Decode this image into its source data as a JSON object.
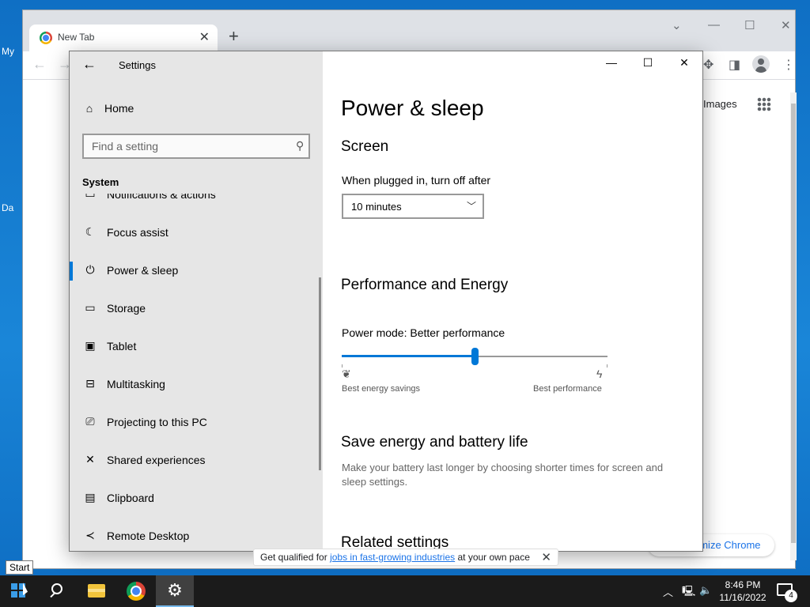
{
  "desktop": {
    "labels": [
      "My",
      "Da"
    ]
  },
  "chrome": {
    "tab_title": "New Tab",
    "tab_close": "✕",
    "new_tab": "+",
    "images_link": "Images",
    "customize_label": "omize Chrome"
  },
  "settings": {
    "window_title": "Settings",
    "back_icon": "←",
    "home_label": "Home",
    "search_placeholder": "Find a setting",
    "section_label": "System",
    "nav_items": [
      {
        "label": "Notifications & actions",
        "icon": "notifications-icon",
        "glyph": "▭"
      },
      {
        "label": "Focus assist",
        "icon": "moon-icon",
        "glyph": "☾"
      },
      {
        "label": "Power & sleep",
        "icon": "power-icon",
        "glyph": "⏻"
      },
      {
        "label": "Storage",
        "icon": "storage-icon",
        "glyph": "▭"
      },
      {
        "label": "Tablet",
        "icon": "tablet-icon",
        "glyph": "▣"
      },
      {
        "label": "Multitasking",
        "icon": "multitasking-icon",
        "glyph": "⊟"
      },
      {
        "label": "Projecting to this PC",
        "icon": "projecting-icon",
        "glyph": "⎚"
      },
      {
        "label": "Shared experiences",
        "icon": "shared-experiences-icon",
        "glyph": "✕"
      },
      {
        "label": "Clipboard",
        "icon": "clipboard-icon",
        "glyph": "📋"
      },
      {
        "label": "Remote Desktop",
        "icon": "remote-desktop-icon",
        "glyph": "≺"
      }
    ],
    "active_item": "Power & sleep",
    "window_controls": {
      "minimize": "—",
      "maximize": "☐",
      "close": "✕"
    }
  },
  "content": {
    "page_title": "Power & sleep",
    "screen_heading": "Screen",
    "plugged_label": "When plugged in, turn off after",
    "plugged_value": "10 minutes",
    "perf_heading": "Performance and Energy",
    "power_mode_label": "Power mode: Better performance",
    "power_mode_level": 0.5,
    "slider_left_label": "Best energy savings",
    "slider_right_label": "Best performance",
    "save_heading": "Save energy and battery life",
    "save_desc": "Make your battery last longer by choosing shorter times for screen and sleep settings.",
    "related_heading": "Related settings"
  },
  "infobar": {
    "text_before": "Get qualified for ",
    "link_text": "jobs in fast-growing industries",
    "text_after": " at your own pace",
    "close": "✕"
  },
  "taskbar": {
    "start_tooltip": "Start",
    "time": "8:46 PM",
    "date": "11/16/2022",
    "notification_count": "4"
  },
  "colors": {
    "accent": "#0078d7",
    "desktop": "#1478c8",
    "taskbar": "#1b1b1b",
    "settings_sidebar": "#e6e6e6"
  }
}
